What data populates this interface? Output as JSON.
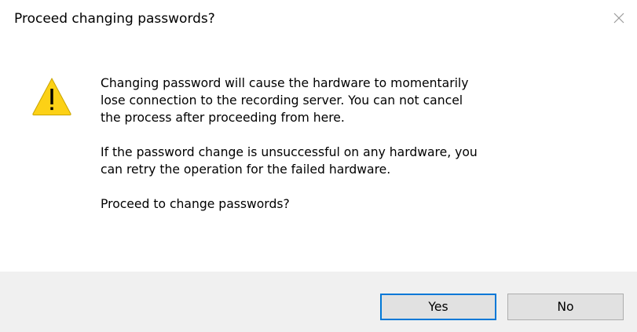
{
  "window": {
    "title": "Proceed changing passwords?"
  },
  "icons": {
    "warning": "warning-icon",
    "close": "close-icon"
  },
  "message": {
    "paragraph1": "Changing password will cause the hardware to momentarily\nlose connection to the recording server. You can not cancel\nthe process after proceeding from here.",
    "paragraph2": "If the password change is unsuccessful on any hardware, you\ncan retry the operation for the failed hardware.",
    "paragraph3": "Proceed to change passwords?"
  },
  "buttons": {
    "yes_label": "Yes",
    "no_label": "No"
  },
  "colors": {
    "footer_bg": "#f0f0f0",
    "default_button_border": "#0078d7",
    "warning_fill": "#fcd116"
  }
}
